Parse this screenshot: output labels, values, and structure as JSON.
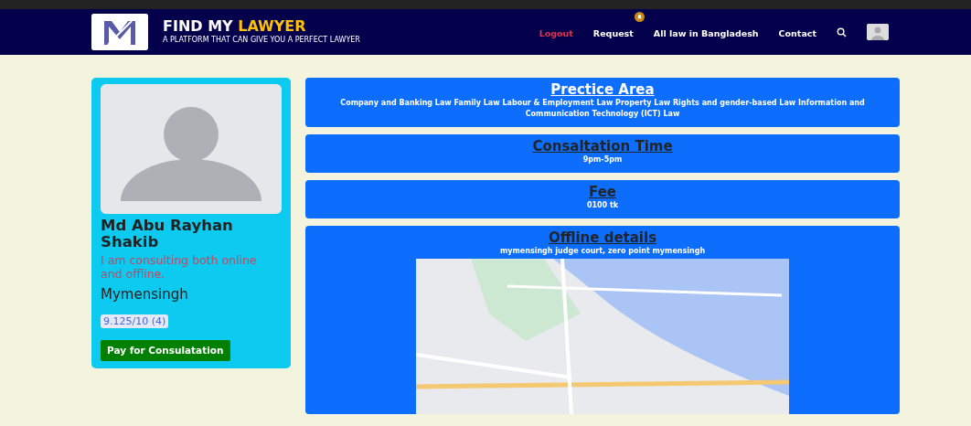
{
  "brand": {
    "title_first": "FIND MY",
    "title_second": "LAWYER",
    "tagline": "A PLATFORM THAT CAN GIVE YOU A PERFECT LAWYER"
  },
  "nav": [
    {
      "label": "Logout",
      "kind": "danger",
      "notification": false
    },
    {
      "label": "Request",
      "kind": "plain",
      "notification": true
    },
    {
      "label": "All law in Bangladesh",
      "kind": "plain",
      "notification": false
    },
    {
      "label": "Contact",
      "kind": "plain",
      "notification": false
    }
  ],
  "profile": {
    "name": "Md Abu Rayhan Shakib",
    "status": "I am consulting both online and offline.",
    "city": "Mymensingh",
    "rating": "9.125/10 (4)",
    "button": "Pay for Consulatation"
  },
  "sections": [
    {
      "title": "Prectice Area",
      "color": "#ffffff",
      "text": "Company and Banking Law Family Law Labour & Employment Law Property Law Rights and gender-based Law Information and Communication Technology (ICT) Law"
    },
    {
      "title": "Consaltation Time",
      "color": "#212529",
      "text": "9pm-5pm"
    },
    {
      "title": "Fee",
      "color": "#212529",
      "text": "0100 tk"
    },
    {
      "title": "Offline details",
      "color": "#212529",
      "text": "mymensingh judge court, zero point mymensingh",
      "map": true
    }
  ]
}
